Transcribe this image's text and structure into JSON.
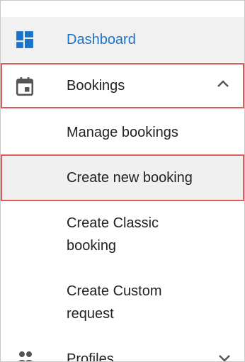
{
  "menu": {
    "dashboard": {
      "label": "Dashboard",
      "icon": "dashboard-icon",
      "active_color": "#1a73c9"
    },
    "bookings": {
      "label": "Bookings",
      "icon": "calendar-icon",
      "expanded_icon": "chevron-up-icon",
      "subitems": [
        {
          "label": "Manage bookings"
        },
        {
          "label": "Create new booking"
        },
        {
          "label": "Create Classic\nbooking"
        },
        {
          "label": "Create Custom\nrequest"
        }
      ]
    },
    "profiles": {
      "label": "Profiles",
      "icon": "people-icon",
      "collapsed_icon": "chevron-down-icon"
    }
  },
  "highlight_color": "#e05a5a"
}
